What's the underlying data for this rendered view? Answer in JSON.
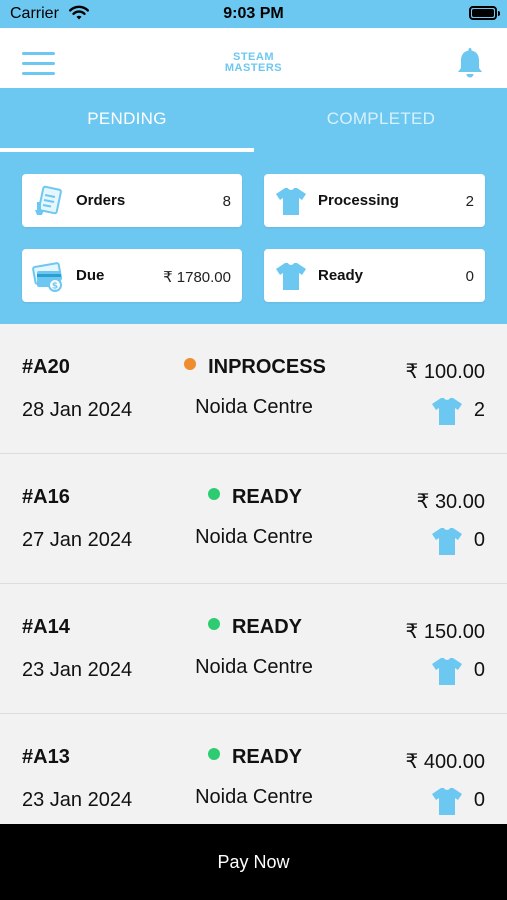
{
  "status_bar": {
    "carrier": "Carrier",
    "time": "9:03 PM"
  },
  "header": {
    "logo_line1": "STEAM",
    "logo_line2": "MASTERS"
  },
  "tabs": [
    {
      "label": "PENDING",
      "active": true
    },
    {
      "label": "COMPLETED",
      "active": false
    }
  ],
  "summary": {
    "orders": {
      "label": "Orders",
      "value": "8",
      "icon": "receipt-icon"
    },
    "processing": {
      "label": "Processing",
      "value": "2",
      "icon": "tshirt-icon"
    },
    "due": {
      "label": "Due",
      "value": "₹ 1780.00",
      "icon": "payment-card-icon"
    },
    "ready": {
      "label": "Ready",
      "value": "0",
      "icon": "tshirt-icon"
    }
  },
  "orders": [
    {
      "id": "#A20",
      "date": "28 Jan 2024",
      "status": "INPROCESS",
      "status_color": "#ee8c2e",
      "location": "Noida Centre",
      "price": "₹ 100.00",
      "items": "2"
    },
    {
      "id": "#A16",
      "date": "27 Jan 2024",
      "status": "READY",
      "status_color": "#2ecc71",
      "location": "Noida Centre",
      "price": "₹ 30.00",
      "items": "0"
    },
    {
      "id": "#A14",
      "date": "23 Jan 2024",
      "status": "READY",
      "status_color": "#2ecc71",
      "location": "Noida Centre",
      "price": "₹ 150.00",
      "items": "0"
    },
    {
      "id": "#A13",
      "date": "23 Jan 2024",
      "status": "READY",
      "status_color": "#2ecc71",
      "location": "Noida Centre",
      "price": "₹ 400.00",
      "items": "0"
    }
  ],
  "pay_button": {
    "label": "Pay Now"
  },
  "colors": {
    "accent": "#6dc8f1",
    "black": "#000000"
  }
}
